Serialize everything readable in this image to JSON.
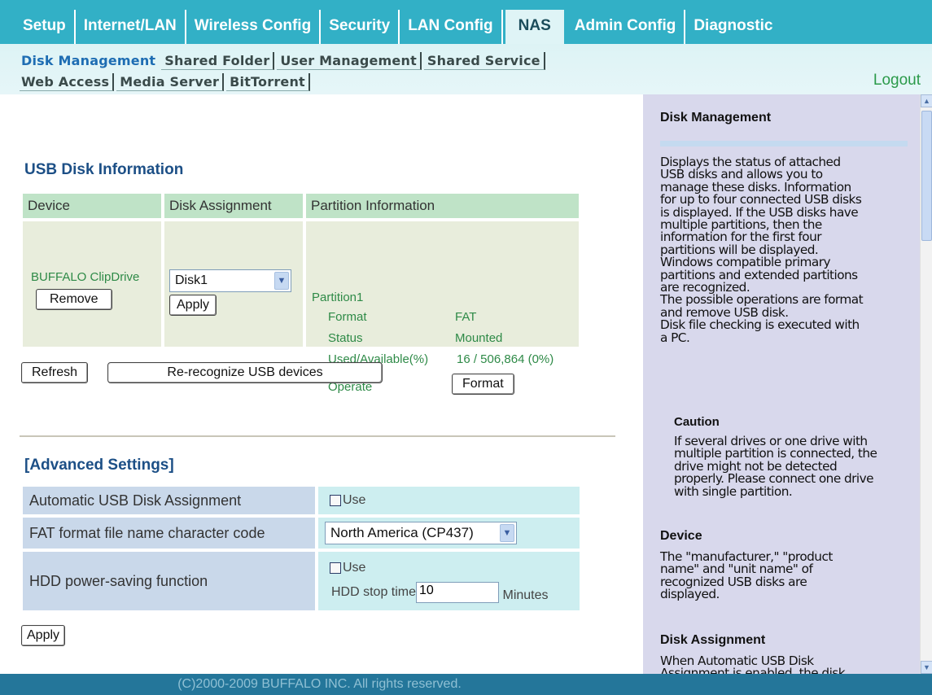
{
  "topnav": {
    "tabs": [
      {
        "label": "Setup"
      },
      {
        "label": "Internet/LAN"
      },
      {
        "label": "Wireless Config"
      },
      {
        "label": "Security"
      },
      {
        "label": "LAN Config"
      },
      {
        "label": "NAS",
        "active": true
      },
      {
        "label": "Admin Config"
      },
      {
        "label": "Diagnostic"
      }
    ]
  },
  "subnav": {
    "row1": [
      {
        "label": "Disk Management",
        "active": true
      },
      {
        "label": "Shared Folder"
      },
      {
        "label": "User Management"
      },
      {
        "label": "Shared Service"
      }
    ],
    "row2": [
      {
        "label": "Web Access"
      },
      {
        "label": "Media Server"
      },
      {
        "label": "BitTorrent"
      }
    ],
    "logout": "Logout"
  },
  "usb": {
    "title": "USB Disk Information",
    "headers": {
      "device": "Device",
      "assignment": "Disk Assignment",
      "partition": "Partition Information"
    },
    "device_name": "BUFFALO ClipDrive",
    "remove_label": "Remove",
    "assignment_value": "Disk1",
    "apply_label": "Apply",
    "partition": {
      "name": "Partition1",
      "format_label": "Format",
      "format_value": "FAT",
      "status_label": "Status",
      "status_value": "Mounted",
      "used_label": "Used/Available(%)",
      "used_value": "16 / 506,864 (0%)",
      "operate_label": "Operate",
      "format_button": "Format"
    },
    "refresh_label": "Refresh",
    "rerecognize_label": "Re-recognize USB devices"
  },
  "advanced": {
    "title": "[Advanced Settings]",
    "auto_label": "Automatic USB Disk Assignment",
    "auto_use": "Use",
    "fat_label": "FAT format file name character code",
    "fat_value": "North America (CP437)",
    "hdd_label": "HDD power-saving function",
    "hdd_use": "Use",
    "hdd_stop_label": "HDD stop time",
    "hdd_stop_value": "10",
    "hdd_stop_unit": "Minutes",
    "apply_label": "Apply"
  },
  "help": {
    "title": "Disk Management",
    "intro": "Displays the status of attached\nUSB disks and allows you to\nmanage these disks. Information\nfor up to four connected USB disks\nis displayed. If the USB disks have\nmultiple partitions, then the\ninformation for the first four\npartitions will be displayed.\nWindows compatible primary\npartitions and extended partitions\nare recognized.\nThe possible operations are format\nand remove USB disk.\nDisk file checking is executed with\na PC.",
    "caution_title": "Caution",
    "caution_text": "If several drives or one drive with\nmultiple partition is connected, the\ndrive might not be detected\nproperly. Please connect one drive\nwith single partition.",
    "device_title": "Device",
    "device_text": "The \"manufacturer,\" \"product\nname\" and \"unit name\" of\nrecognized USB disks are\ndisplayed.",
    "assignment_title": "Disk Assignment",
    "assignment_text": "When Automatic USB Disk\nAssignment is enabled, the disk"
  },
  "footer": "(C)2000-2009 BUFFALO INC. All rights reserved.",
  "colors": {
    "nav_bg": "#32b0c6",
    "footer_bg": "#24769a",
    "help_bg": "#d8d8ec",
    "title_blue": "#1c4f86",
    "device_green": "#2e8a47"
  }
}
